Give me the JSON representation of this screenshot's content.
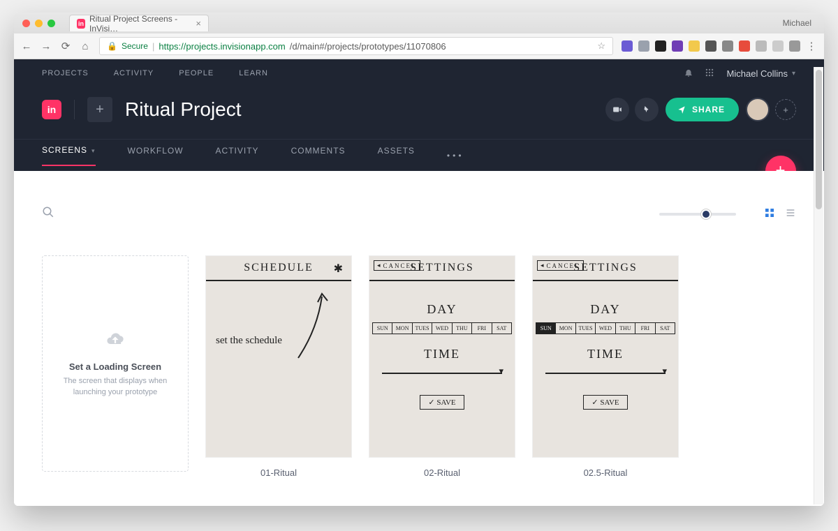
{
  "browser": {
    "tab_title": "Ritual Project Screens - InVisi…",
    "profile": "Michael",
    "secure_label": "Secure",
    "url_host": "https://projects.invisionapp.com",
    "url_path": "/d/main#/projects/prototypes/11070806"
  },
  "app": {
    "topnav": [
      "PROJECTS",
      "ACTIVITY",
      "PEOPLE",
      "LEARN"
    ],
    "user": "Michael Collins",
    "project_title": "Ritual Project",
    "share_label": "SHARE",
    "tabs": [
      "SCREENS",
      "WORKFLOW",
      "ACTIVITY",
      "COMMENTS",
      "ASSETS"
    ],
    "active_tab": "SCREENS"
  },
  "placeholder": {
    "title": "Set a Loading Screen",
    "subtitle": "The screen that displays when launching your prototype"
  },
  "screens": [
    {
      "caption": "01-Ritual",
      "type": "schedule",
      "header": "SCHEDULE",
      "note": "set the schedule"
    },
    {
      "caption": "02-Ritual",
      "type": "settings",
      "header": "SETTINGS",
      "cancel": "CANCEL",
      "day_label": "DAY",
      "days": [
        "SUN",
        "MON",
        "TUES",
        "WED",
        "THU",
        "FRI",
        "SAT"
      ],
      "selected_day": null,
      "time_label": "TIME",
      "save_label": "SAVE"
    },
    {
      "caption": "02.5-Ritual",
      "type": "settings",
      "header": "SETTINGS",
      "cancel": "CANCEL",
      "day_label": "DAY",
      "days": [
        "SUN",
        "MON",
        "TUES",
        "WED",
        "THU",
        "FRI",
        "SAT"
      ],
      "selected_day": "SUN",
      "time_label": "TIME",
      "save_label": "SAVE"
    }
  ]
}
